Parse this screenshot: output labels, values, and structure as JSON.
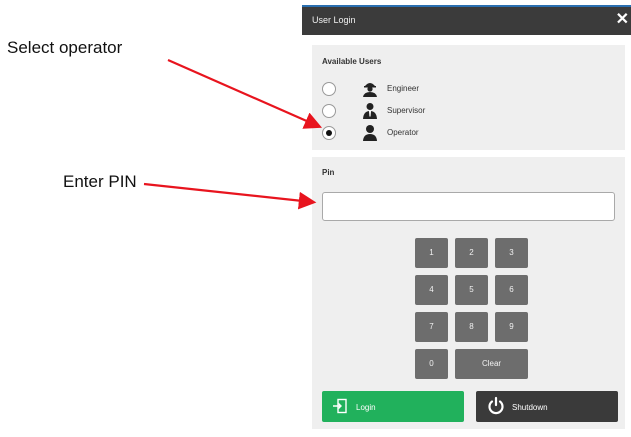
{
  "callouts": {
    "select_operator": "Select operator",
    "enter_pin": "Enter PIN"
  },
  "dialog": {
    "title": "User Login",
    "close_glyph": "✕"
  },
  "users_panel": {
    "heading": "Available Users",
    "users": [
      {
        "label": "Engineer",
        "icon": "engineer-icon",
        "selected": false
      },
      {
        "label": "Supervisor",
        "icon": "supervisor-icon",
        "selected": false
      },
      {
        "label": "Operator",
        "icon": "operator-icon",
        "selected": true
      }
    ]
  },
  "pin_panel": {
    "heading": "Pin",
    "pin_value": "",
    "keys": [
      "1",
      "2",
      "3",
      "4",
      "5",
      "6",
      "7",
      "8",
      "9",
      "0",
      "Clear"
    ]
  },
  "buttons": {
    "login_label": "Login",
    "shutdown_label": "Shutdown"
  },
  "colors": {
    "titlebar": "#3b3b3b",
    "login": "#21b15c",
    "shutdown": "#3a3a3a",
    "keypad": "#6d6d6d",
    "arrow": "#e8141e"
  }
}
